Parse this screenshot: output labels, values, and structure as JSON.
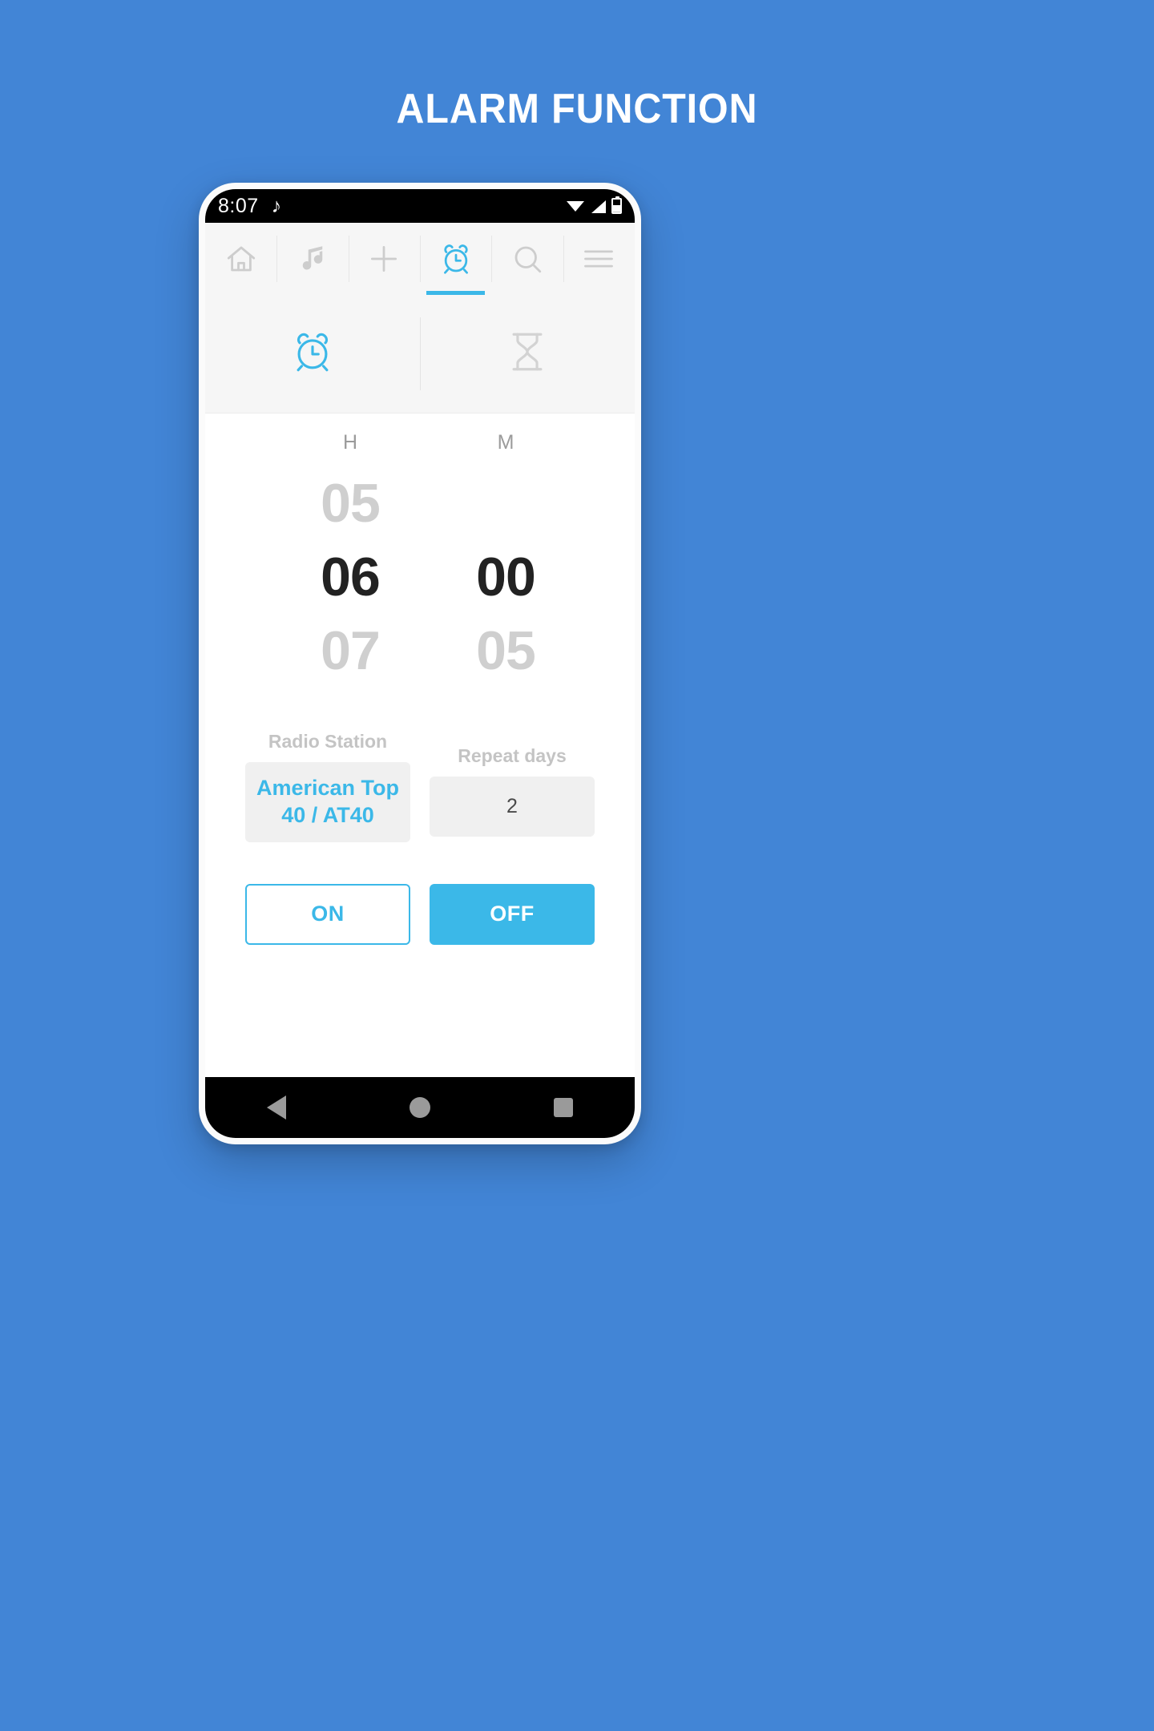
{
  "page": {
    "title": "ALARM FUNCTION",
    "background_color": "#4285d6",
    "accent_color": "#3bb8e8"
  },
  "status_bar": {
    "time": "8:07",
    "music_note_icon": "music-note-icon",
    "wifi_icon": "wifi-icon",
    "signal_icon": "signal-icon",
    "battery_icon": "battery-icon"
  },
  "top_nav": {
    "items": [
      {
        "name": "home",
        "icon": "home-icon",
        "active": false
      },
      {
        "name": "music",
        "icon": "music-note-icon",
        "active": false
      },
      {
        "name": "add",
        "icon": "plus-icon",
        "active": false
      },
      {
        "name": "alarm",
        "icon": "alarm-clock-icon",
        "active": true
      },
      {
        "name": "search",
        "icon": "search-icon",
        "active": false
      },
      {
        "name": "menu",
        "icon": "hamburger-menu-icon",
        "active": false
      }
    ]
  },
  "sub_tabs": {
    "items": [
      {
        "name": "alarm",
        "icon": "alarm-clock-icon",
        "active": true
      },
      {
        "name": "timer",
        "icon": "hourglass-icon",
        "active": false
      }
    ]
  },
  "time_picker": {
    "hours": {
      "header": "H",
      "previous": "05",
      "selected": "06",
      "next": "07"
    },
    "minutes": {
      "header": "M",
      "previous": "",
      "selected": "00",
      "next": "05"
    }
  },
  "radio_station": {
    "label": "Radio Station",
    "value": "American Top 40 / AT40"
  },
  "repeat_days": {
    "label": "Repeat days",
    "value": "2"
  },
  "buttons": {
    "on_label": "ON",
    "off_label": "OFF"
  },
  "bottom_nav": {
    "back_icon": "back-triangle-icon",
    "home_icon": "home-circle-icon",
    "recents_icon": "recents-square-icon"
  }
}
